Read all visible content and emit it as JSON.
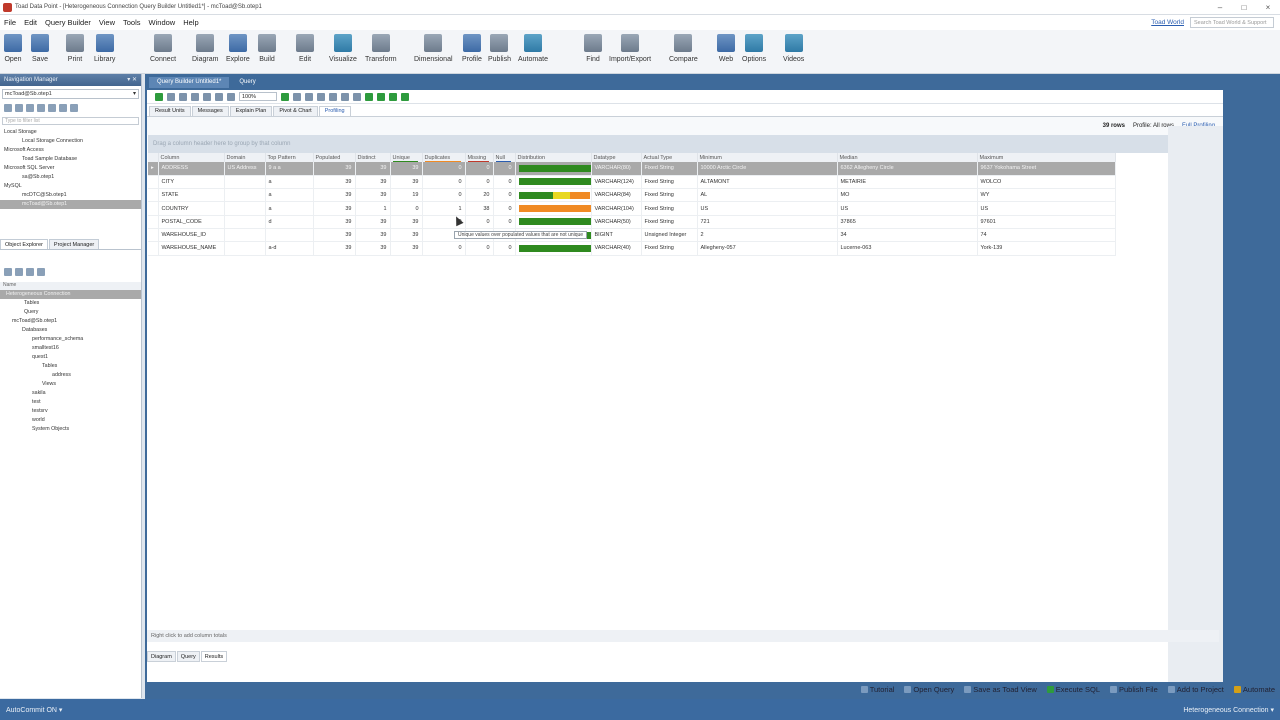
{
  "app": {
    "title": "Toad Data Point - [Heterogeneous Connection Query Builder Untitled1*] - mcToad@Sb.otep1",
    "window_controls": [
      "–",
      "□",
      "×"
    ]
  },
  "menu": {
    "items": [
      "File",
      "Edit",
      "Query Builder",
      "View",
      "Tools",
      "Window",
      "Help"
    ],
    "toad_world": "Toad World",
    "search_placeholder": "Search Toad World & Support"
  },
  "ribbon": {
    "buttons": [
      {
        "label": "Open",
        "icon": "open-folder-icon"
      },
      {
        "label": "Save",
        "icon": "save-disk-icon"
      },
      {
        "label": "Print",
        "icon": "printer-icon"
      },
      {
        "label": "Library",
        "icon": "library-icon"
      },
      {
        "label": "Connect",
        "icon": "connect-plug-icon"
      },
      {
        "label": "Diagram",
        "icon": "diagram-icon"
      },
      {
        "label": "Explore",
        "icon": "explore-icon"
      },
      {
        "label": "Build",
        "icon": "build-icon"
      },
      {
        "label": "Edit",
        "icon": "edit-pencil-icon"
      },
      {
        "label": "Visualize",
        "icon": "visualize-chart-icon"
      },
      {
        "label": "Transform",
        "icon": "transform-icon"
      },
      {
        "label": "Dimensional",
        "icon": "dimensional-icon"
      },
      {
        "label": "Profile",
        "icon": "profile-user-icon"
      },
      {
        "label": "Publish",
        "icon": "publish-icon"
      },
      {
        "label": "Automate",
        "icon": "lightning-icon"
      },
      {
        "label": "Find",
        "icon": "find-binoculars-icon"
      },
      {
        "label": "Import/Export",
        "icon": "import-export-icon"
      },
      {
        "label": "Compare",
        "icon": "compare-icon"
      },
      {
        "label": "Web",
        "icon": "web-globe-icon"
      },
      {
        "label": "Options",
        "icon": "options-icon"
      },
      {
        "label": "Videos",
        "icon": "videos-camera-icon"
      }
    ]
  },
  "nav": {
    "title": "Navigation Manager",
    "connection": "mcToad@Sb.otep1",
    "filter_placeholder": "Type to filter list",
    "tree": [
      "Local Storage",
      "Local Storage Connection",
      "Microsoft Access",
      "Toad Sample Database",
      "Microsoft SQL Server",
      "sa@Sb.otep1",
      "MySQL",
      "mcDTC@Sb.otep1",
      "mcToad@Sb.otep1"
    ],
    "tabs": [
      "Object Explorer",
      "Project Manager"
    ],
    "obj_header": "Name",
    "obj_tree": [
      "Heterogeneous Connection",
      "Tables",
      "Query",
      "mcToad@Sb.otep1",
      "Databases",
      "performance_schema",
      "smalltest16",
      "quest1",
      "Tables",
      "address",
      "Views",
      "sakila",
      "test",
      "testsrv",
      "world",
      "System Objects"
    ]
  },
  "doc": {
    "tabs": [
      "Query Builder Untitled1*",
      "Query"
    ]
  },
  "toolbar": {
    "zoom": "100%"
  },
  "result_tabs": [
    "Result Units",
    "Messages",
    "Explain Plan",
    "Pivot & Chart",
    "Profiling"
  ],
  "summary": {
    "rows": "39 rows",
    "profile": "Profile: All rows",
    "full_link": "Full Profiling"
  },
  "group_hint": "Drag a column header here to group by that column",
  "grid": {
    "headers": [
      "Column",
      "Domain",
      "Top Pattern",
      "Populated",
      "Distinct",
      "Unique",
      "Duplicates",
      "Missing",
      "Null",
      "Distribution",
      "Datatype",
      "Actual Type",
      "Minimum",
      "Median",
      "Maximum"
    ],
    "rows": [
      [
        "ADDRESS",
        "US Address",
        "9 a a",
        "39",
        "39",
        "39",
        "0",
        "0",
        "0",
        "VARCHAR(80)",
        "Fixed String",
        "10000 Arctic Circle",
        "6362 Allegheny Circle",
        "9637 Yokohama Street"
      ],
      [
        "CITY",
        "",
        "a",
        "39",
        "39",
        "39",
        "0",
        "0",
        "0",
        "VARCHAR(124)",
        "Fixed String",
        "ALTAMONT",
        "METAIRIE",
        "WOLCO"
      ],
      [
        "STATE",
        "",
        "a",
        "39",
        "39",
        "19",
        "0",
        "20",
        "0",
        "VARCHAR(84)",
        "Fixed String",
        "AL",
        "MO",
        "WY"
      ],
      [
        "COUNTRY",
        "",
        "a",
        "39",
        "1",
        "0",
        "1",
        "38",
        "0",
        "VARCHAR(104)",
        "Fixed String",
        "US",
        "US",
        "US"
      ],
      [
        "POSTAL_CODE",
        "",
        "d",
        "39",
        "39",
        "39",
        "0",
        "0",
        "0",
        "VARCHAR(50)",
        "Fixed String",
        "721",
        "37865",
        "97601"
      ],
      [
        "WAREHOUSE_ID",
        "",
        "",
        "39",
        "39",
        "39",
        "0",
        "0",
        "0",
        "BIGINT",
        "Unsigned Integer",
        "2",
        "34",
        "74"
      ],
      [
        "WAREHOUSE_NAME",
        "",
        "a-d",
        "39",
        "39",
        "39",
        "0",
        "0",
        "0",
        "VARCHAR(40)",
        "Fixed String",
        "Allegheny-057",
        "Lucerne-063",
        "York-139"
      ]
    ],
    "distribution": [
      [
        {
          "color": "#2f8a1f",
          "pct": 100
        }
      ],
      [
        {
          "color": "#2f8a1f",
          "pct": 100
        }
      ],
      [
        {
          "color": "#2f8a1f",
          "pct": 48
        },
        {
          "color": "#e8d820",
          "pct": 24
        },
        {
          "color": "#f08a24",
          "pct": 28
        }
      ],
      [
        {
          "color": "#f08a24",
          "pct": 100
        }
      ],
      [
        {
          "color": "#2f8a1f",
          "pct": 100
        }
      ],
      [
        {
          "color": "#2f8a1f",
          "pct": 100
        }
      ],
      [
        {
          "color": "#2f8a1f",
          "pct": 100
        }
      ]
    ]
  },
  "tooltip": "Unique values over populated values that are not unique",
  "footer": {
    "info": "Right click to add column totals",
    "bottom_tabs": [
      "Diagram",
      "Query",
      "Results"
    ]
  },
  "actions": [
    "Tutorial",
    "Open Query",
    "Save as Toad View",
    "Execute SQL",
    "Publish File",
    "Add to Project",
    "Automate"
  ],
  "status": {
    "left": "AutoCommit ON ▾",
    "right": "Heterogeneous Connection ▾"
  }
}
